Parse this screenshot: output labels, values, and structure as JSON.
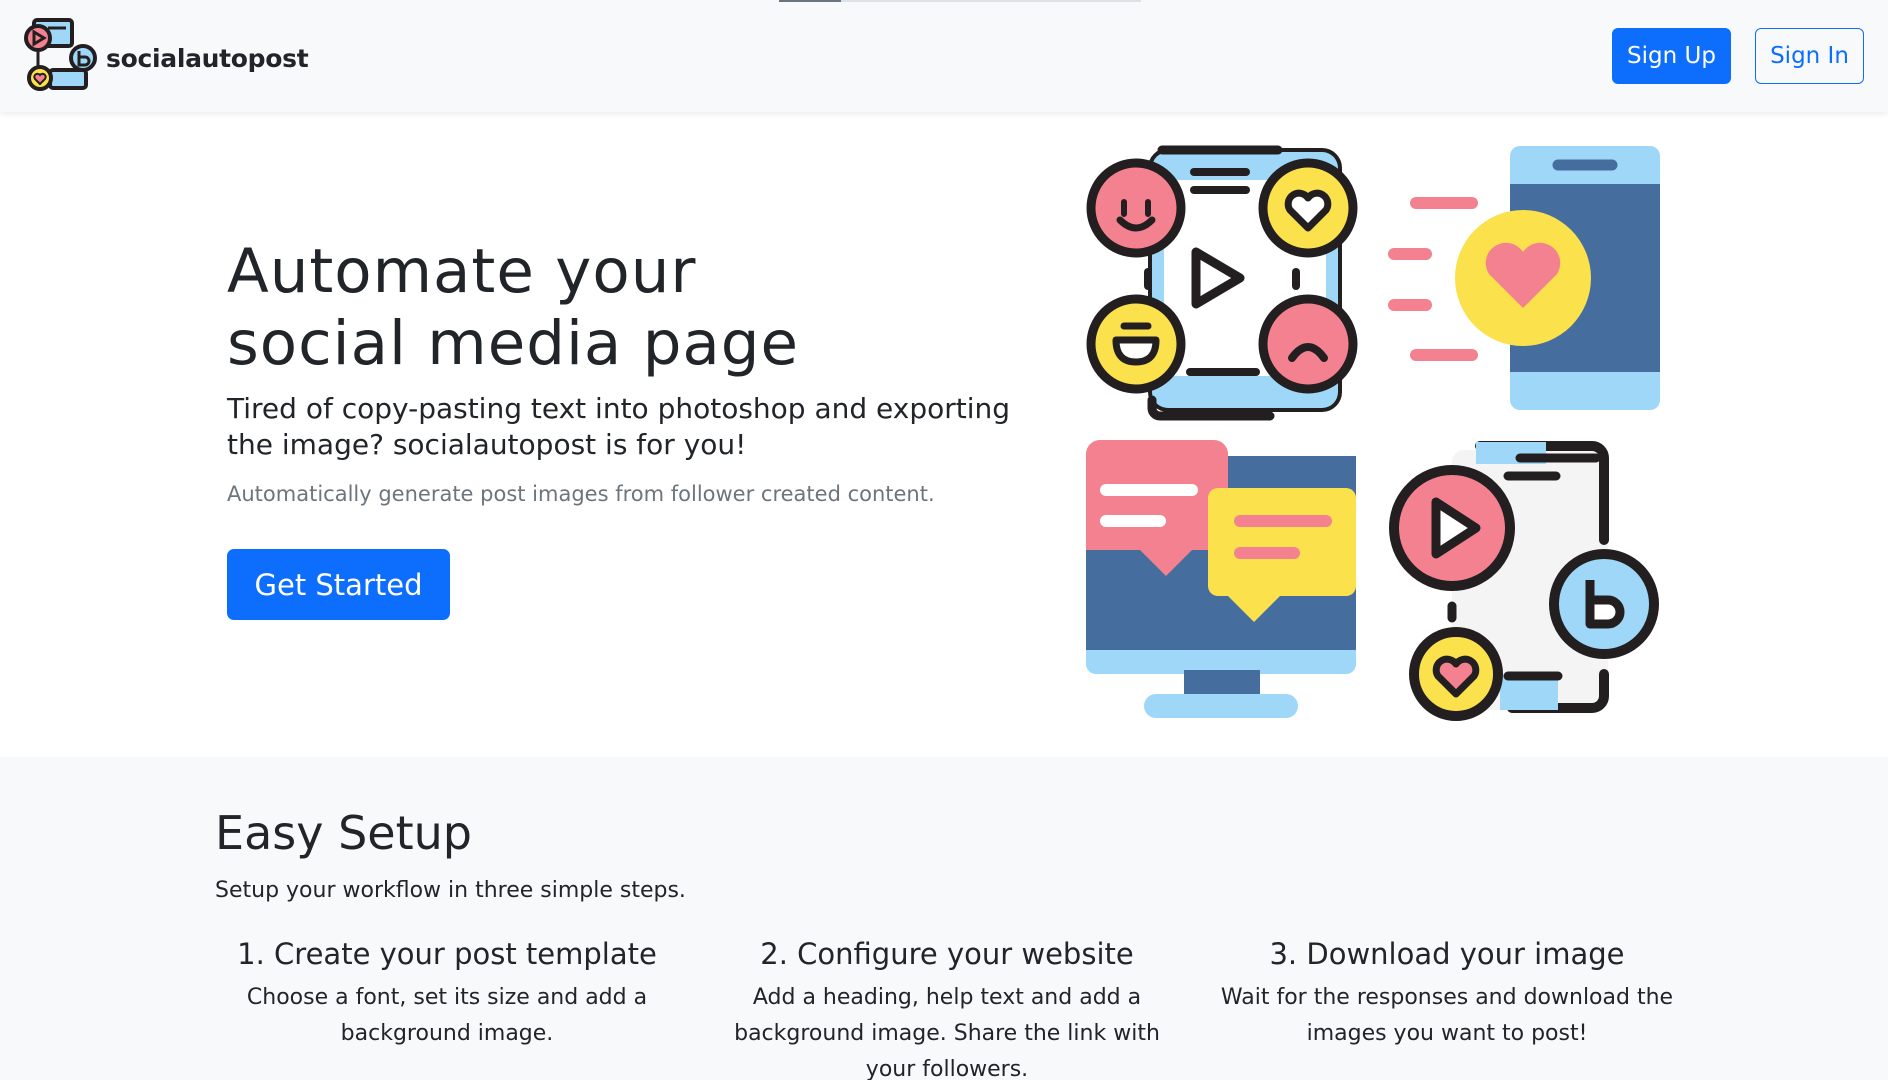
{
  "nav": {
    "brand": "socialautopost",
    "signup_label": "Sign Up",
    "signin_label": "Sign In",
    "icon": "social-network-logo-icon"
  },
  "hero": {
    "title_line1": "Automate your",
    "title_line2": "social media page",
    "lead": "Tired of copy-pasting text into photoshop and exporting the image? socialautopost is for you!",
    "muted": "Automatically generate post images from follower created content.",
    "cta_label": "Get Started",
    "illustration": "social-media-icons-illustration"
  },
  "setup": {
    "title": "Easy Setup",
    "subtitle": "Setup your workflow in three simple steps.",
    "steps": [
      {
        "title": "1. Create your post template",
        "text": "Choose a font, set its size and add a background image."
      },
      {
        "title": "2. Configure your website",
        "text": "Add a heading, help text and add a background image. Share the link with your followers."
      },
      {
        "title": "3. Download your image",
        "text": "Wait for the responses and download the images you want to post!"
      }
    ]
  },
  "colors": {
    "primary": "#0d6efd",
    "muted": "#6c757d",
    "light_bg": "#f8f9fa",
    "pink": "#f3818f",
    "yellow": "#fbe14b",
    "light_blue": "#9ed7f7",
    "dark_blue": "#456e9e",
    "outline": "#231f20"
  },
  "page_progress": 0.17
}
